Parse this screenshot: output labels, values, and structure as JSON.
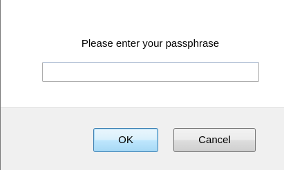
{
  "dialog": {
    "prompt": "Please enter your passphrase",
    "passphrase": {
      "value": "",
      "placeholder": ""
    },
    "buttons": {
      "ok_label": "OK",
      "cancel_label": "Cancel"
    }
  }
}
